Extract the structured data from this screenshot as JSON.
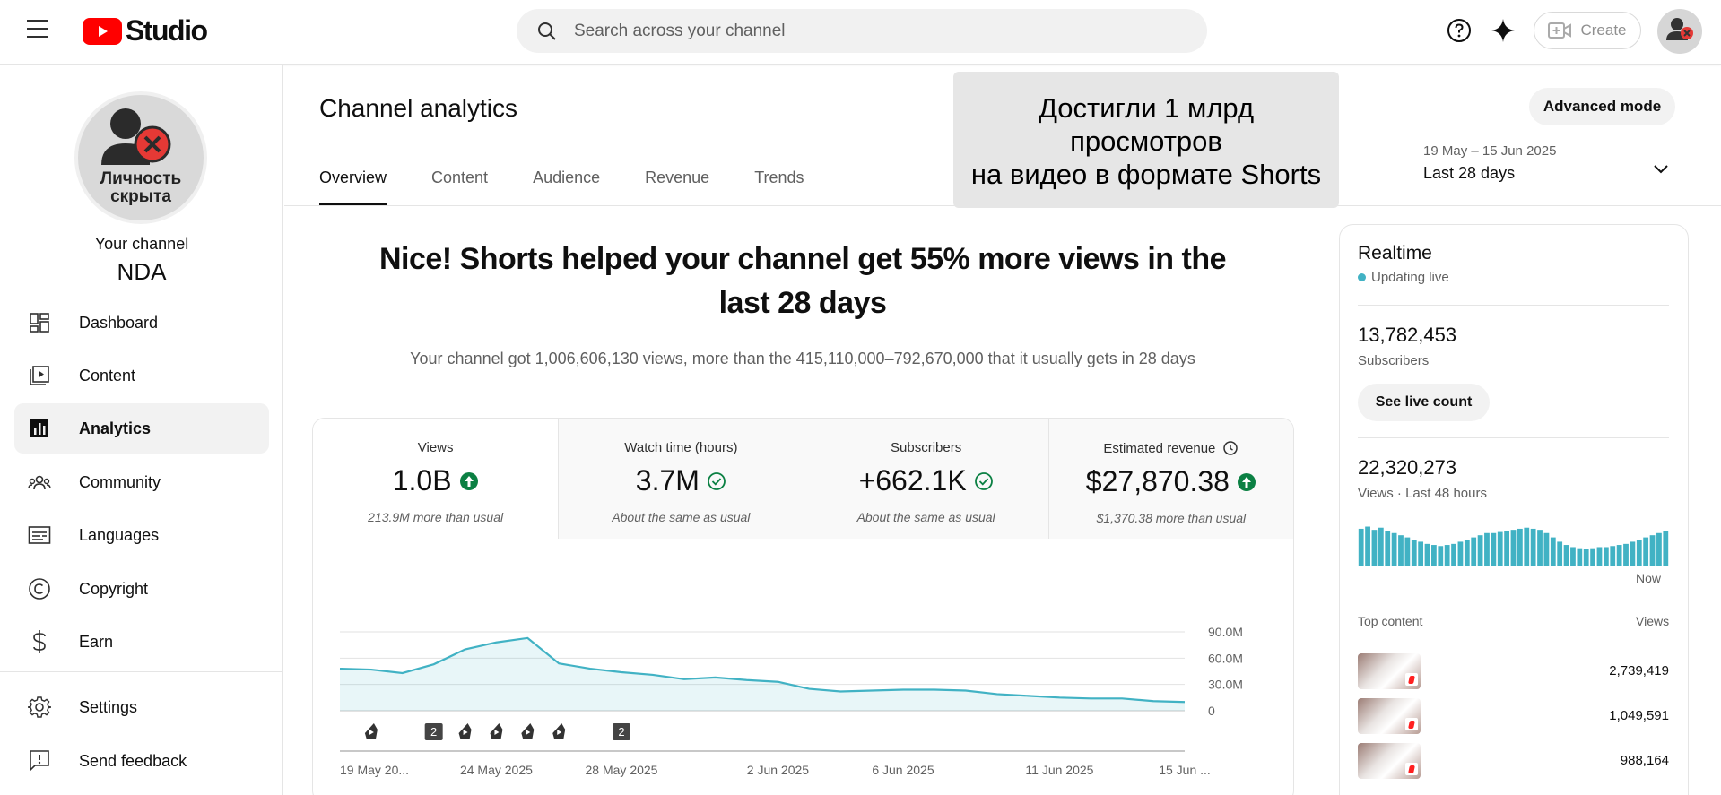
{
  "app": {
    "name": "Studio"
  },
  "search": {
    "placeholder": "Search across your channel"
  },
  "topbar": {
    "create_label": "Create",
    "avatar_caption": "Личность скрыта"
  },
  "sidebar": {
    "avatar_caption": "Личность скрыта",
    "your_channel": "Your channel",
    "channel_name": "NDA",
    "items": [
      {
        "label": "Dashboard",
        "icon": "dashboard-icon"
      },
      {
        "label": "Content",
        "icon": "content-icon"
      },
      {
        "label": "Analytics",
        "icon": "analytics-icon",
        "active": true
      },
      {
        "label": "Community",
        "icon": "community-icon"
      },
      {
        "label": "Languages",
        "icon": "languages-icon"
      },
      {
        "label": "Copyright",
        "icon": "copyright-icon"
      },
      {
        "label": "Earn",
        "icon": "earn-icon"
      }
    ],
    "footer_items": [
      {
        "label": "Settings",
        "icon": "gear-icon"
      },
      {
        "label": "Send feedback",
        "icon": "feedback-icon"
      }
    ]
  },
  "page": {
    "title": "Channel analytics",
    "tabs": [
      "Overview",
      "Content",
      "Audience",
      "Revenue",
      "Trends"
    ],
    "active_tab": "Overview",
    "overlay_note": [
      "Достигли 1 млрд",
      "просмотров",
      "на видео в формате Shorts"
    ],
    "advanced_mode_label": "Advanced mode",
    "date_range": "19 May – 15 Jun 2025",
    "date_label": "Last 28 days"
  },
  "headline": {
    "title": "Nice! Shorts helped your channel get 55% more views in the last 28 days",
    "subtitle": "Your channel got 1,006,606,130 views, more than the 415,110,000–792,670,000 that it usually gets in 28 days"
  },
  "metrics": [
    {
      "label": "Views",
      "value": "1.0B",
      "status": "up",
      "note": "213.9M more than usual"
    },
    {
      "label": "Watch time (hours)",
      "value": "3.7M",
      "status": "check",
      "note": "About the same as usual"
    },
    {
      "label": "Subscribers",
      "value": "+662.1K",
      "status": "check",
      "note": "About the same as usual"
    },
    {
      "label": "Estimated revenue",
      "value": "$27,870.38",
      "status": "up",
      "note": "$1,370.38 more than usual",
      "has_info_icon": true
    }
  ],
  "colors": {
    "accent": "#41b2c4",
    "brand_red": "#ff0000",
    "positive_green": "#0b8043"
  },
  "chart_data": {
    "type": "area",
    "x": [
      "19 May 2025",
      "20 May 2025",
      "21 May 2025",
      "22 May 2025",
      "23 May 2025",
      "24 May 2025",
      "25 May 2025",
      "26 May 2025",
      "27 May 2025",
      "28 May 2025",
      "29 May 2025",
      "30 May 2025",
      "31 May 2025",
      "1 Jun 2025",
      "2 Jun 2025",
      "3 Jun 2025",
      "4 Jun 2025",
      "5 Jun 2025",
      "6 Jun 2025",
      "7 Jun 2025",
      "8 Jun 2025",
      "9 Jun 2025",
      "10 Jun 2025",
      "11 Jun 2025",
      "12 Jun 2025",
      "13 Jun 2025",
      "14 Jun 2025",
      "15 Jun 2025"
    ],
    "series": [
      {
        "values": [
          48,
          47,
          43,
          53,
          70,
          78,
          83,
          54,
          48,
          44,
          41,
          36,
          38,
          35,
          33,
          25,
          22,
          23,
          24,
          24,
          23,
          19,
          17,
          15,
          14,
          14,
          11,
          10
        ]
      }
    ],
    "x_tick_labels": [
      {
        "label": "19 May 20...",
        "index": 0
      },
      {
        "label": "24 May 2025",
        "index": 5
      },
      {
        "label": "28 May 2025",
        "index": 9
      },
      {
        "label": "2 Jun 2025",
        "index": 14
      },
      {
        "label": "6 Jun 2025",
        "index": 18
      },
      {
        "label": "11 Jun 2025",
        "index": 23
      },
      {
        "label": "15 Jun ...",
        "index": 27
      }
    ],
    "y_ticks": [
      0,
      30,
      60,
      90
    ],
    "y_tick_labels": [
      "0",
      "30.0M",
      "60.0M",
      "90.0M"
    ],
    "ylim": [
      0,
      90
    ],
    "markers": [
      {
        "index": 1,
        "kind": "shorts"
      },
      {
        "index": 3,
        "kind": "count",
        "label": "2"
      },
      {
        "index": 4,
        "kind": "shorts"
      },
      {
        "index": 5,
        "kind": "shorts"
      },
      {
        "index": 6,
        "kind": "shorts"
      },
      {
        "index": 7,
        "kind": "shorts"
      },
      {
        "index": 9,
        "kind": "count",
        "label": "2"
      }
    ],
    "color": "#41b2c4",
    "grid": true
  },
  "realtime": {
    "title": "Realtime",
    "live_label": "Updating live",
    "subscribers": "13,782,453",
    "subscribers_label": "Subscribers",
    "see_live_label": "See live count",
    "views": "22,320,273",
    "views_label": "Views · Last 48 hours",
    "now_label": "Now",
    "bars": [
      34,
      36,
      33,
      35,
      32,
      30,
      28,
      26,
      24,
      22,
      20,
      19,
      18,
      19,
      20,
      22,
      24,
      26,
      28,
      30,
      30,
      31,
      32,
      33,
      34,
      35,
      34,
      33,
      30,
      26,
      22,
      19,
      17,
      16,
      15,
      16,
      17,
      17,
      18,
      19,
      20,
      22,
      24,
      26,
      28,
      30,
      32
    ],
    "top_content_label": "Top content",
    "top_views_label": "Views",
    "top_content": [
      {
        "views": "2,739,419"
      },
      {
        "views": "1,049,591"
      },
      {
        "views": "988,164"
      }
    ]
  }
}
